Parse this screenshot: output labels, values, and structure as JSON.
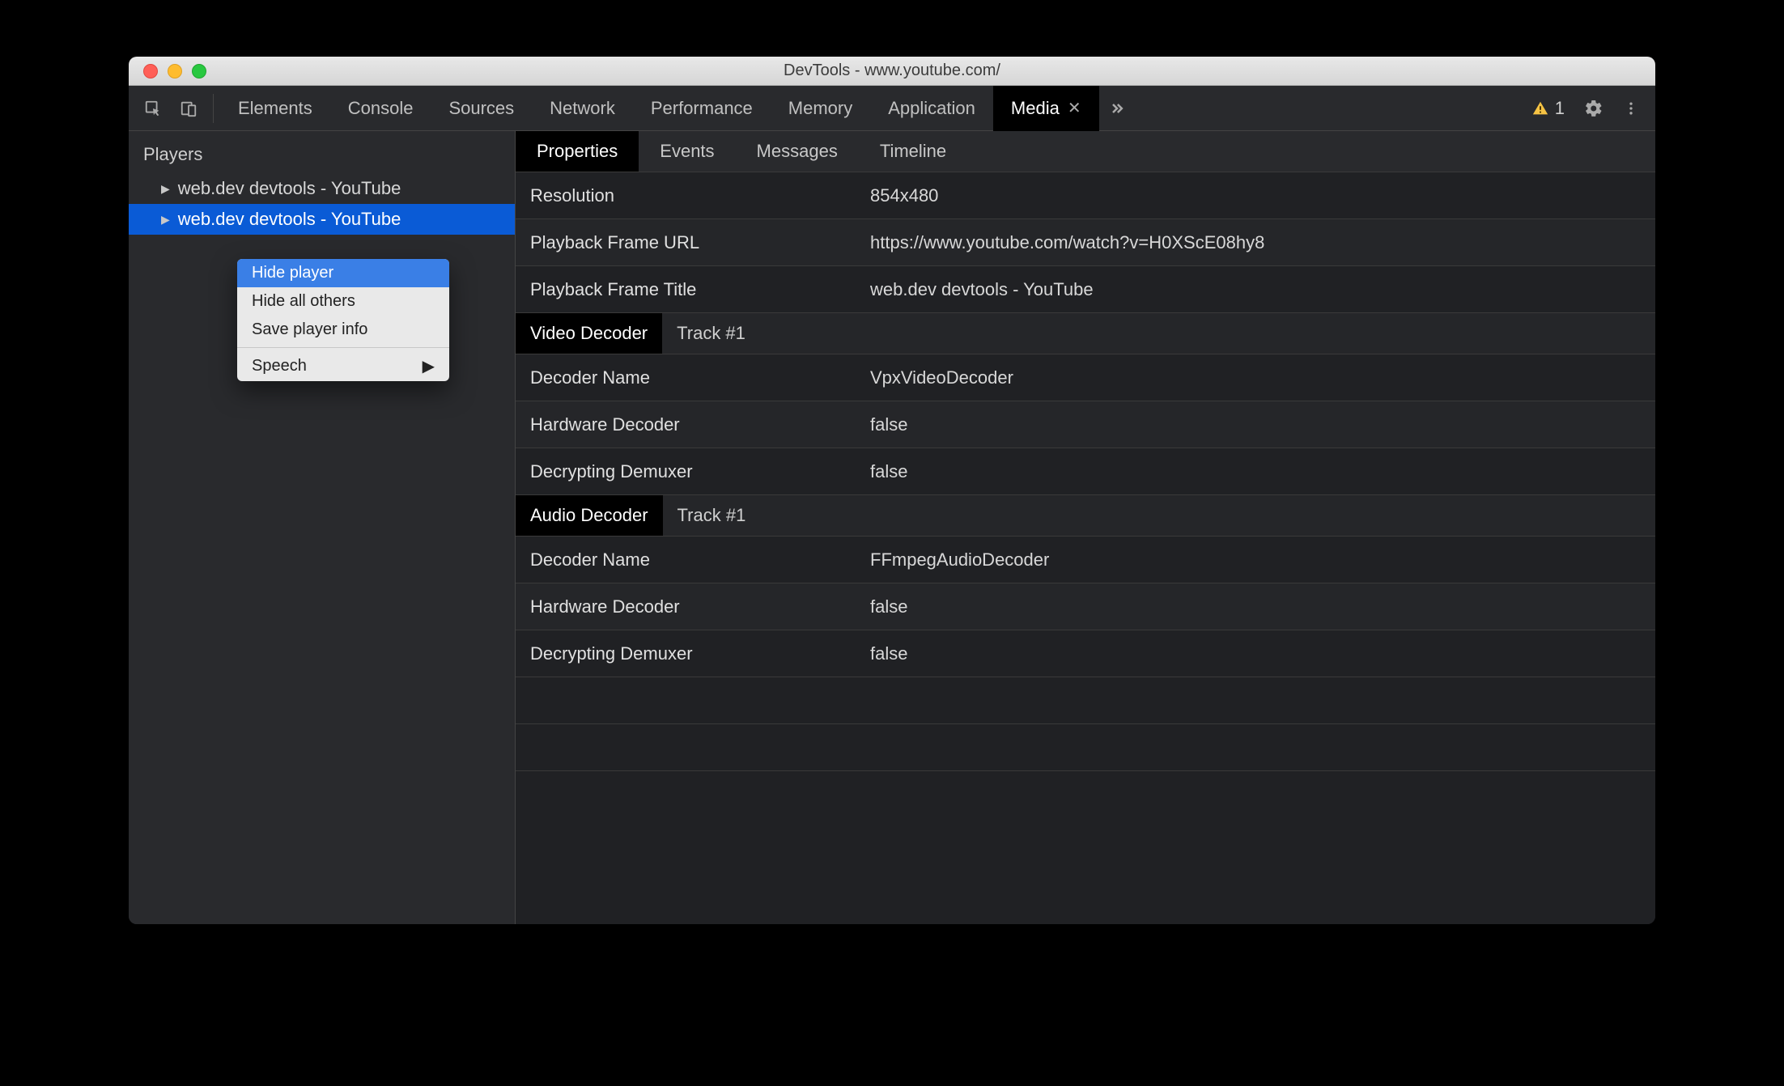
{
  "window": {
    "title": "DevTools - www.youtube.com/"
  },
  "toolbar": {
    "tabs": {
      "elements": "Elements",
      "console": "Console",
      "sources": "Sources",
      "network": "Network",
      "performance": "Performance",
      "memory": "Memory",
      "application": "Application",
      "media": "Media"
    },
    "warning_count": "1"
  },
  "sidebar": {
    "header": "Players",
    "items": [
      {
        "label": "web.dev devtools - YouTube"
      },
      {
        "label": "web.dev devtools - YouTube"
      }
    ]
  },
  "context_menu": {
    "hide_player": "Hide player",
    "hide_others": "Hide all others",
    "save_info": "Save player info",
    "speech": "Speech"
  },
  "main": {
    "tabs": {
      "properties": "Properties",
      "events": "Events",
      "messages": "Messages",
      "timeline": "Timeline"
    },
    "rows": {
      "resolution_k": "Resolution",
      "resolution_v": "854x480",
      "frame_url_k": "Playback Frame URL",
      "frame_url_v": "https://www.youtube.com/watch?v=H0XScE08hy8",
      "frame_title_k": "Playback Frame Title",
      "frame_title_v": "web.dev devtools - YouTube"
    },
    "video_section": {
      "label": "Video Decoder",
      "track": "Track #1",
      "decoder_name_k": "Decoder Name",
      "decoder_name_v": "VpxVideoDecoder",
      "hw_k": "Hardware Decoder",
      "hw_v": "false",
      "decrypt_k": "Decrypting Demuxer",
      "decrypt_v": "false"
    },
    "audio_section": {
      "label": "Audio Decoder",
      "track": "Track #1",
      "decoder_name_k": "Decoder Name",
      "decoder_name_v": "FFmpegAudioDecoder",
      "hw_k": "Hardware Decoder",
      "hw_v": "false",
      "decrypt_k": "Decrypting Demuxer",
      "decrypt_v": "false"
    }
  }
}
